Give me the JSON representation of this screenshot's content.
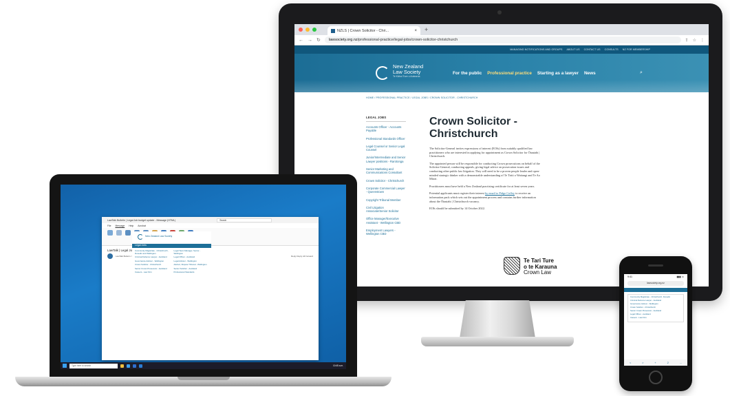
{
  "browser": {
    "tab_title": "NZLS | Crown Solicitor - Chri...",
    "url_domain": "lawsociety.org.nz",
    "url_path": "/professional-practice/legal-jobs/crown-solicitor-christchurch"
  },
  "site": {
    "top_links": [
      "MANAGING NOTIFICATIONS AND GROUPS",
      "ABOUT US",
      "CONTACT US",
      "CONSULTS",
      "NZ FOR MEMBERSHIP"
    ],
    "logo_line1": "New Zealand",
    "logo_line2": "Law Society",
    "logo_line3": "Te Kāhui Ture o Aotearoa",
    "menu": [
      "For the public",
      "Professional practice",
      "Starting as a lawyer",
      "News"
    ],
    "breadcrumb": "HOME / PROFESSIONAL PRACTICE / LEGAL JOBS / CROWN SOLICITOR - CHRISTCHURCH",
    "sidebar_heading": "LEGAL JOBS",
    "sidebar_items": [
      "Accounts Officer - Accounts Payable",
      "Professional Standards Officer",
      "Legal Counsel or Senior Legal Counsel",
      "Junior/Intermediate and Senior Lawyer positions - Rarotonga",
      "Senior Marketing and Communications Consultant",
      "Crown Solicitor - Christchurch",
      "Corporate Commercial Lawyer - Queenstown",
      "Copyright Tribunal Member",
      "Civil Litigation Associate/Senior Solicitor",
      "Office Manager/Executive Assistant - Wellington CBD",
      "Employment Lawyers - Wellington CBD"
    ],
    "title": "Crown Solicitor - Christchurch",
    "paragraphs": [
      "The Solicitor-General invites expressions of interest (EOIs) from suitably qualified law practitioners who are interested in applying for appointment as Crown Solicitor for Ōtautahi | Christchurch.",
      "The appointed person will be responsible for conducting Crown prosecutions on behalf of the Solicitor-General, conducting appeals, giving legal advice on prosecution issues and conducting other public law litigation. They will need to be a proven people leader and open-minded strategic thinker with a demonstrable understanding of Te Tiriti o Waitangi and Te Ao Māori.",
      "Practitioners must have held a New Zealand practising certificate for at least seven years.",
      "Potential applicants must register their interest",
      "EOIs should be submitted by 14 October 2022."
    ],
    "para4_link": "by email to Pidge Coffey",
    "para4_rest": "to receive an information pack which sets out the appointment process and contains further information about the Ōtautahi | Christchurch vacancy.",
    "crown_law_line1": "Te Tari Ture",
    "crown_law_line2": "o te Karauna",
    "crown_law_line3": "Crown Law"
  },
  "laptop": {
    "window_title": "LawTalk Bulletin | Legal Job budget update - Message (HTML)",
    "search_placeholder": "Search",
    "menu": [
      "File",
      "Message",
      "Help",
      "Acrobat"
    ],
    "subject": "LawTalk | Legal Job budget update",
    "from": "LawTalk Bulletin <lawtalk@lawsociety.org.nz>",
    "actions": "Reply  Reply All  Forward",
    "email_logo": "New Zealand Law Society",
    "email_heading": "Legal Jobs",
    "col1": [
      "Community Magistrate - Christchurch, Dunedin and Wellington",
      "Criminal Defence Lawyer - Auckland",
      "Governance Advisor - Wellington",
      "Crown Solicitor - Christchurch",
      "Senior Crown Prosecutor - Auckland",
      "Careers - Law Firm"
    ],
    "col2": [
      "Legal Team Manager, Senior - Wellington",
      "Legal Officer - Auckland",
      "Legal Advisor - Wellington",
      "Advisor, Dispute Tribunal - Wellington",
      "Senior Solicitor - Auckland",
      "Professional Standards"
    ],
    "taskbar_search": "Type here to search",
    "clock": "10:45 a.m."
  },
  "phone": {
    "time": "9:41",
    "url": "lawsociety.org.nz",
    "items": [
      "Community Magistrate - Christchurch, Dunedin",
      "Criminal Defence Lawyer - Auckland",
      "Governance Advisor - Wellington",
      "Crown Solicitor - Christchurch",
      "Senior Crown Prosecutor - Auckland",
      "Legal Officer - Auckland",
      "Careers - Law Firm"
    ],
    "bottom": [
      "<",
      ">",
      "+",
      "2",
      "..."
    ]
  },
  "colors": {
    "brand": "#1d6f98",
    "header_dark": "#10577c",
    "accent_active": "#ffde7a",
    "desktop_blue": "#1674c4"
  }
}
